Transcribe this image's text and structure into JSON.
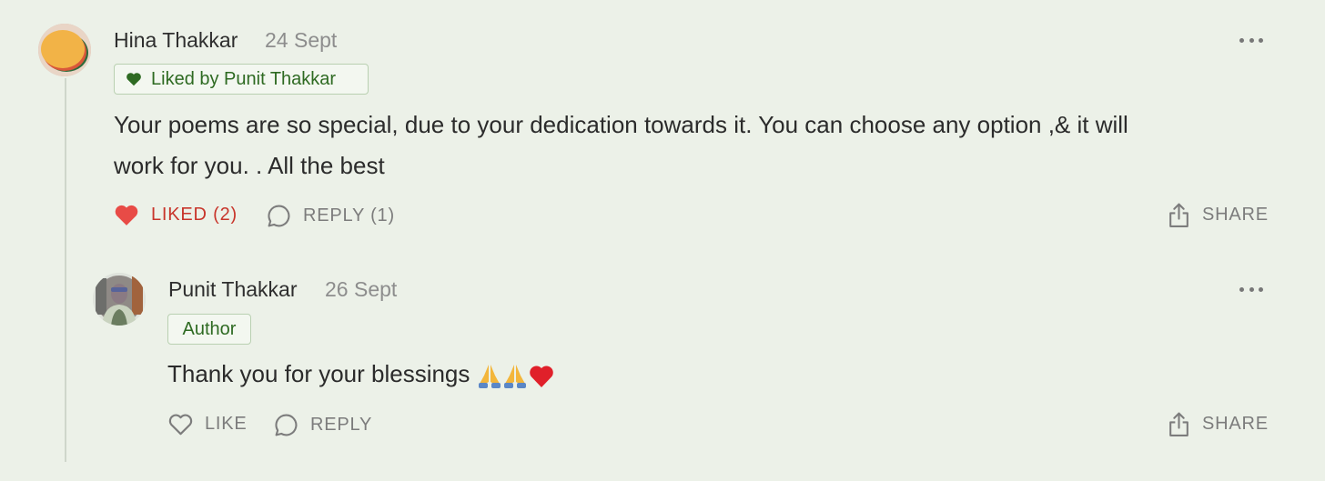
{
  "comments": [
    {
      "author": "Hina Thakkar",
      "date": "24 Sept",
      "tag": "Liked by Punit Thakkar",
      "body_line1": "Your poems are so special, due to your dedication towards it. You can choose any option ,& it will",
      "body_line2": "work for you. . All the best",
      "like_label": "LIKED (2)",
      "reply_label": "REPLY (1)",
      "share_label": "SHARE",
      "liked": true
    },
    {
      "author": "Punit Thakkar",
      "date": "26 Sept",
      "tag": "Author",
      "body": "Thank you for your blessings",
      "like_label": "LIKE",
      "reply_label": "REPLY",
      "share_label": "SHARE",
      "liked": false
    }
  ],
  "icons": {
    "liked_heart": "heart-filled-icon",
    "like_heart": "heart-outline-icon",
    "reply": "speech-bubble-icon",
    "share": "share-icon",
    "more": "more-dots-icon",
    "emoji": [
      "folded-hands-emoji",
      "folded-hands-emoji",
      "red-heart-emoji"
    ]
  },
  "colors": {
    "background": "#ECF1E8",
    "liked": "#c8352b",
    "tag_text": "#2e6a22",
    "tag_border": "#b9d0b1"
  }
}
